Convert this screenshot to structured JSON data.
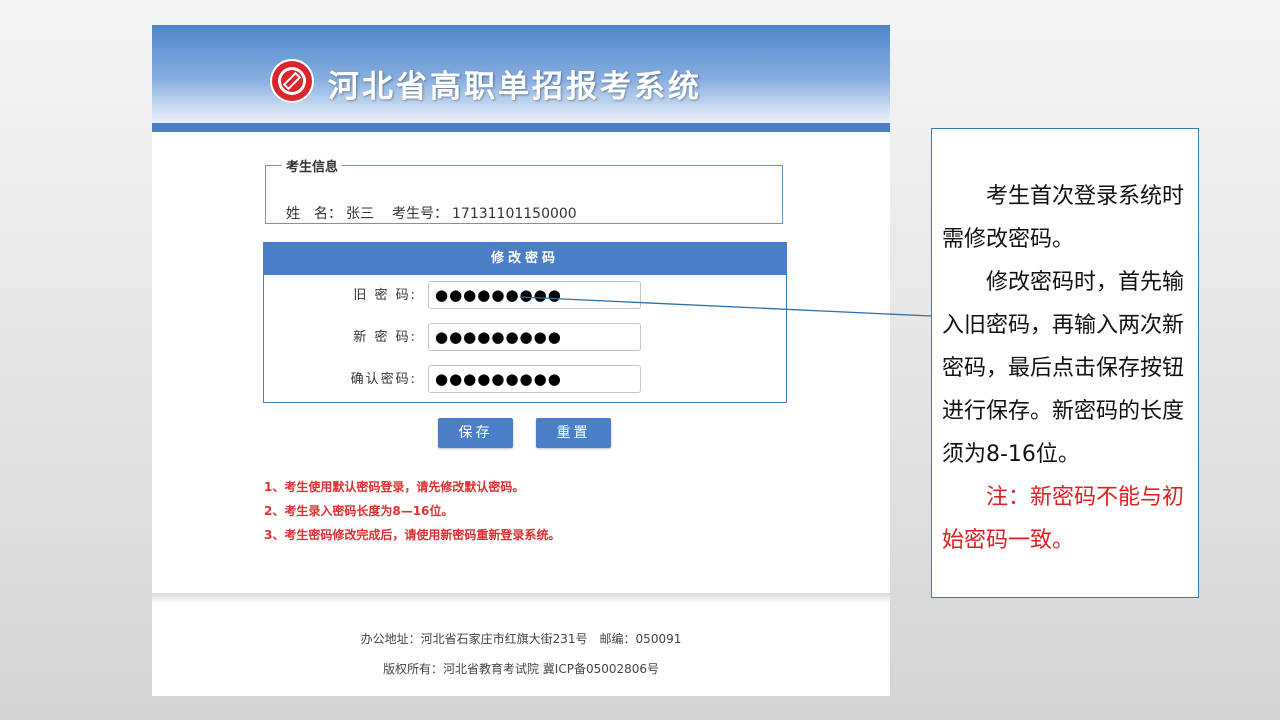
{
  "header": {
    "title": "河北省高职单招报考系统"
  },
  "student_info": {
    "legend": "考生信息",
    "name_label": "姓　名：",
    "name_value": "张三",
    "id_label": "考生号：",
    "id_value": "17131101150000"
  },
  "change_password": {
    "title": "修改密码",
    "fields": [
      {
        "label": "旧 密 码:",
        "value": "●●●●●●●●●"
      },
      {
        "label": "新 密 码:",
        "value": "●●●●●●●●●"
      },
      {
        "label": "确认密码:",
        "value": "●●●●●●●●●"
      }
    ],
    "save_label": "保存",
    "reset_label": "重置"
  },
  "notices": [
    "1、考生使用默认密码登录，请先修改默认密码。",
    "2、考生录入密码长度为8—16位。",
    "3、考生密码修改完成后，请使用新密码重新登录系统。"
  ],
  "footer": {
    "address": "办公地址：河北省石家庄市红旗大街231号　邮编：050091",
    "copyright": "版权所有：河北省教育考试院 冀ICP备05002806号"
  },
  "callout": {
    "p1": "考生首次登录系统时需修改密码。",
    "p2": "修改密码时，首先输入旧密码，再输入两次新密码，最后点击保存按钮进行保存。新密码的长度须为8-16位。",
    "p3": "注：新密码不能与初始密码一致。"
  },
  "colors": {
    "accent": "#4a7fc7",
    "notice": "#e03030",
    "callout_border": "#3a7bb0"
  }
}
